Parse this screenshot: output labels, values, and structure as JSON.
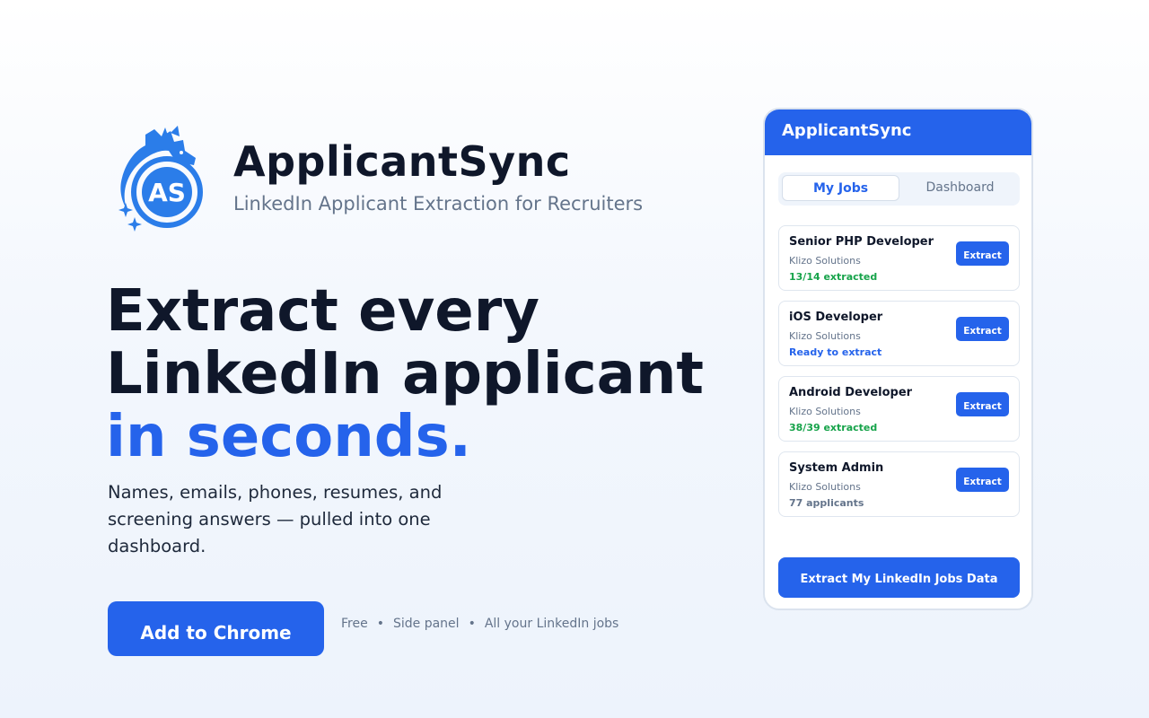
{
  "brand": {
    "name": "ApplicantSync",
    "tagline": "LinkedIn Applicant Extraction for Recruiters",
    "logo_text": "AS",
    "logo_icon": "dragon-logo-icon",
    "accent_color": "#2563eb"
  },
  "hero": {
    "line1": "Extract every",
    "line2": "LinkedIn applicant",
    "line3": "in seconds.",
    "subtitle": "Names, emails, phones, resumes, and screening answers — pulled into one dashboard."
  },
  "cta": {
    "button_label": "Add to Chrome",
    "meta": [
      "Free",
      "Side panel",
      "All your LinkedIn jobs"
    ],
    "separator": "•"
  },
  "panel": {
    "title": "ApplicantSync",
    "tabs": [
      {
        "label": "My Jobs",
        "active": true
      },
      {
        "label": "Dashboard",
        "active": false
      }
    ],
    "jobs": [
      {
        "title": "Senior PHP Developer",
        "company": "Klizo Solutions",
        "status": "13/14 extracted",
        "status_color": "#16a34a",
        "button": "Extract"
      },
      {
        "title": "iOS Developer",
        "company": "Klizo Solutions",
        "status": "Ready to extract",
        "status_color": "#2563eb",
        "button": "Extract"
      },
      {
        "title": "Android Developer",
        "company": "Klizo Solutions",
        "status": "38/39 extracted",
        "status_color": "#16a34a",
        "button": "Extract"
      },
      {
        "title": "System Admin",
        "company": "Klizo Solutions",
        "status": "77 applicants",
        "status_color": "#64748b",
        "button": "Extract"
      }
    ],
    "footer_button": "Extract My LinkedIn Jobs Data"
  }
}
